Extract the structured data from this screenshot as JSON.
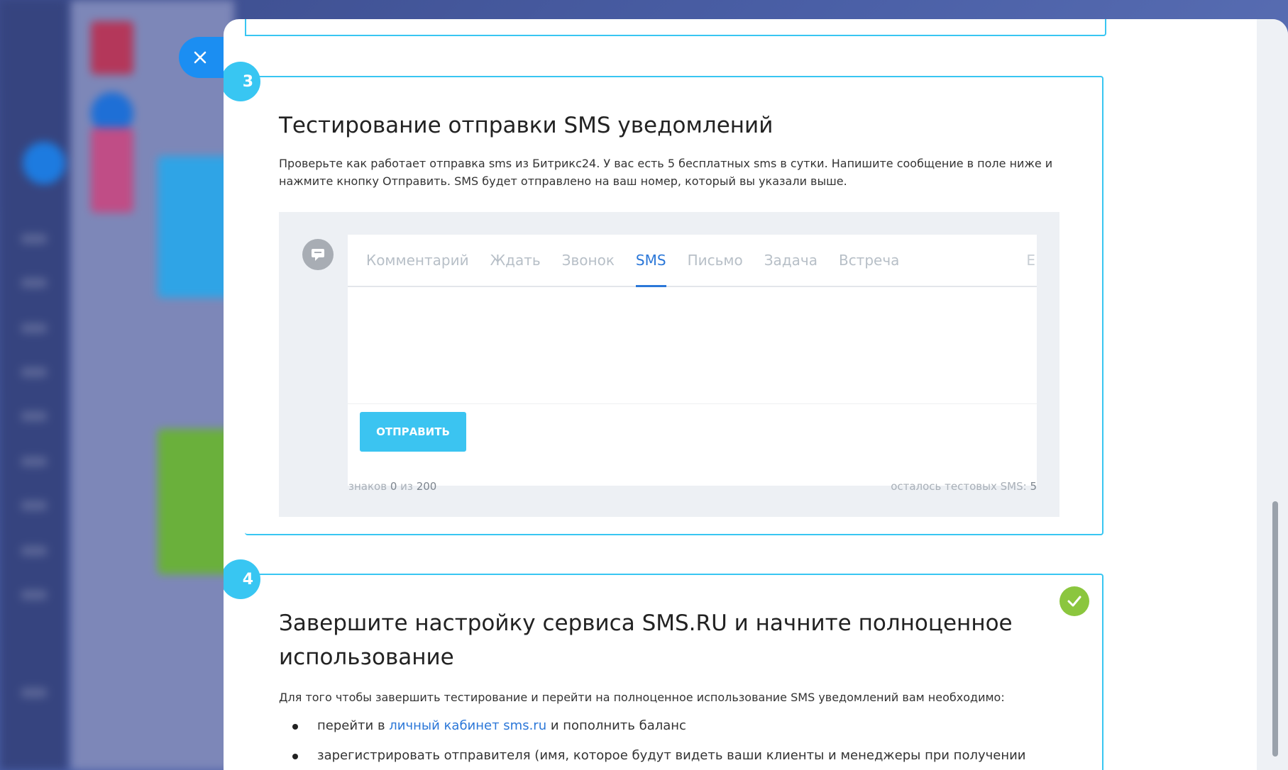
{
  "step3": {
    "number": "3",
    "title": "Тестирование отправки SMS уведомлений",
    "description": "Проверьте как работает отправка sms из Битрикс24. У вас есть 5 бесплатных sms в сутки. Напишите сообщение в поле ниже и нажмите кнопку Отправить. SMS будет отправлено на ваш номер, который вы указали выше.",
    "tabs": [
      {
        "label": "Комментарий",
        "active": false
      },
      {
        "label": "Ждать",
        "active": false
      },
      {
        "label": "Звонок",
        "active": false
      },
      {
        "label": "SMS",
        "active": true
      },
      {
        "label": "Письмо",
        "active": false
      },
      {
        "label": "Задача",
        "active": false
      },
      {
        "label": "Встреча",
        "active": false
      }
    ],
    "tab_more": "Е",
    "send_label": "ОТПРАВИТЬ",
    "counter_prefix": "знаков",
    "counter_value": "0",
    "counter_sep": "из",
    "counter_max": "200",
    "remaining_label": "осталось тестовых SMS:",
    "remaining_value": "5"
  },
  "step4": {
    "number": "4",
    "title": "Завершите настройку сервиса SMS.RU и начните полноценное использование",
    "intro": "Для того чтобы завершить тестирование и перейти на полноценное использование SMS уведомлений вам необходимо:",
    "bullet1_before": "перейти в",
    "bullet1_link": "личный кабинет sms.ru",
    "bullet1_after": "и пополнить баланс",
    "bullet2": "зарегистрировать отправителя (имя, которое будут видеть ваши клиенты и менеджеры при получении"
  },
  "colors": {
    "accent": "#38c6f2",
    "close_button": "#1b8ef2",
    "link": "#2b77d8",
    "success": "#8bc63e"
  }
}
